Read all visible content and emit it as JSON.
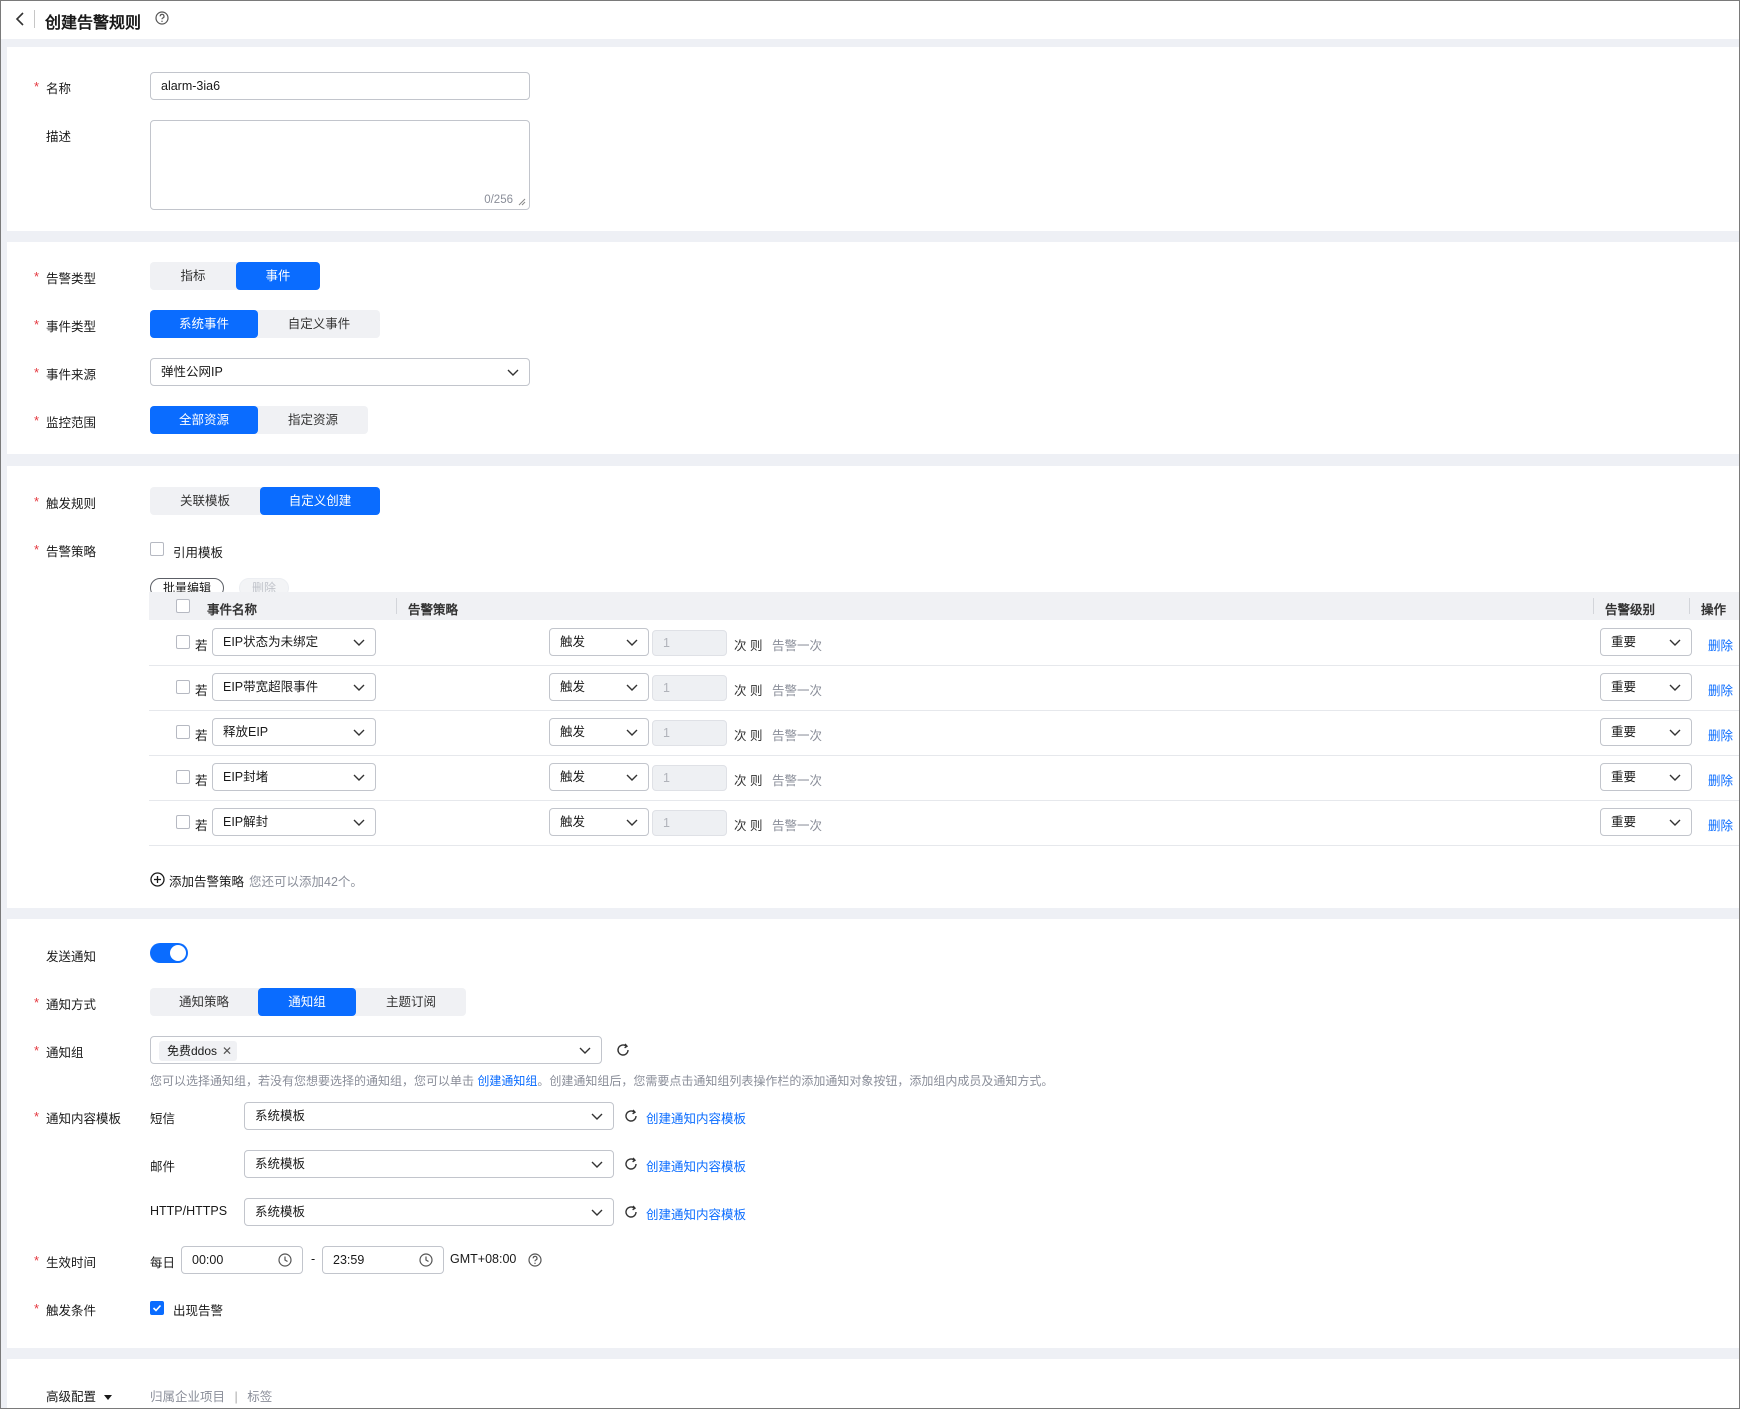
{
  "header": {
    "title": "创建告警规则"
  },
  "basic": {
    "name_label": "名称",
    "name_value": "alarm-3ia6",
    "desc_label": "描述",
    "desc_counter": "0/256"
  },
  "alarm": {
    "type_label": "告警类型",
    "type_options": [
      "指标",
      "事件"
    ],
    "event_type_label": "事件类型",
    "event_type_options": [
      "系统事件",
      "自定义事件"
    ],
    "source_label": "事件来源",
    "source_value": "弹性公网IP",
    "scope_label": "监控范围",
    "scope_options": [
      "全部资源",
      "指定资源"
    ]
  },
  "trigger": {
    "rule_label": "触发规则",
    "rule_options": [
      "关联模板",
      "自定义创建"
    ],
    "policy_label": "告警策略",
    "use_template": "引用模板",
    "batch_edit": "批量编辑",
    "delete": "删除",
    "columns": {
      "event_name": "事件名称",
      "policy": "告警策略",
      "level": "告警级别",
      "action": "操作"
    },
    "rows": [
      {
        "ruo": "若",
        "event": "EIP状态为未绑定",
        "trigger": "触发",
        "count": "1",
        "ci": "次 则",
        "once": "告警一次",
        "level": "重要",
        "action": "删除"
      },
      {
        "ruo": "若",
        "event": "EIP带宽超限事件",
        "trigger": "触发",
        "count": "1",
        "ci": "次 则",
        "once": "告警一次",
        "level": "重要",
        "action": "删除"
      },
      {
        "ruo": "若",
        "event": "释放EIP",
        "trigger": "触发",
        "count": "1",
        "ci": "次 则",
        "once": "告警一次",
        "level": "重要",
        "action": "删除"
      },
      {
        "ruo": "若",
        "event": "EIP封堵",
        "trigger": "触发",
        "count": "1",
        "ci": "次 则",
        "once": "告警一次",
        "level": "重要",
        "action": "删除"
      },
      {
        "ruo": "若",
        "event": "EIP解封",
        "trigger": "触发",
        "count": "1",
        "ci": "次 则",
        "once": "告警一次",
        "level": "重要",
        "action": "删除"
      }
    ],
    "add_policy": "添加告警策略",
    "add_hint": "您还可以添加42个。"
  },
  "notify": {
    "send_label": "发送通知",
    "send_enabled": true,
    "method_label": "通知方式",
    "method_options": [
      "通知策略",
      "通知组",
      "主题订阅"
    ],
    "group_label": "通知组",
    "group_tag": "免费ddos",
    "hint_before": "您可以选择通知组，若没有您想要选择的通知组，您可以单击",
    "hint_link": "创建通知组",
    "hint_after": "。创建通知组后，您需要点击通知组列表操作栏的添加通知对象按钮，添加组内成员及通知方式。",
    "template_label": "通知内容模板",
    "templates": [
      {
        "channel": "短信",
        "value": "系统模板",
        "link": "创建通知内容模板"
      },
      {
        "channel": "邮件",
        "value": "系统模板",
        "link": "创建通知内容模板"
      },
      {
        "channel": "HTTP/HTTPS",
        "value": "系统模板",
        "link": "创建通知内容模板"
      }
    ],
    "time_label": "生效时间",
    "daily": "每日",
    "start": "00:00",
    "dash": "-",
    "end": "23:59",
    "tz": "GMT+08:00",
    "cond_label": "触发条件",
    "cond_value": "出现告警"
  },
  "advanced": {
    "label": "高级配置",
    "item1": "归属企业项目",
    "divider": "|",
    "item2": "标签"
  },
  "colors": {
    "primary": "#0a6cff",
    "required": "#e5373e",
    "bg": "#eef0f5"
  }
}
